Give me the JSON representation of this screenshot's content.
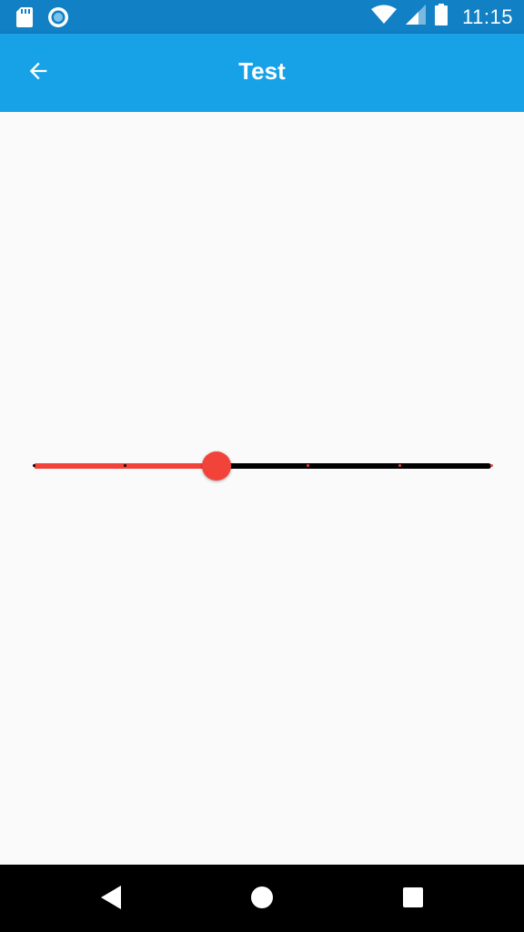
{
  "status_bar": {
    "time": "11:15",
    "icons": [
      "sd-card-icon",
      "circle-notification-icon",
      "wifi-icon",
      "signal-icon",
      "battery-icon"
    ]
  },
  "app_bar": {
    "title": "Test",
    "back_icon": "arrow-back-icon",
    "color": "#17a2e8"
  },
  "slider": {
    "value": 0.4,
    "divisions": 5,
    "active_color": "#f2433a",
    "inactive_color": "#000000"
  },
  "nav_bar": {
    "buttons": [
      "back-triangle-icon",
      "home-circle-icon",
      "recents-square-icon"
    ]
  }
}
